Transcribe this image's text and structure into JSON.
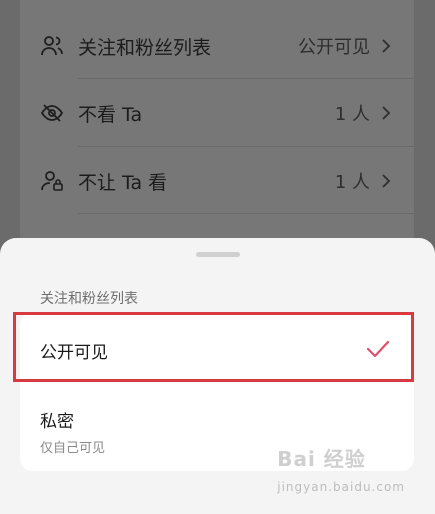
{
  "background_list": {
    "items": [
      {
        "icon": "people-icon",
        "label": "关注和粉丝列表",
        "value": "公开可见"
      },
      {
        "icon": "eye-off-icon",
        "label": "不看 Ta",
        "value": "1 人"
      },
      {
        "icon": "person-lock-icon",
        "label": "不让 Ta 看",
        "value": "1 人"
      }
    ]
  },
  "sheet": {
    "title": "关注和粉丝列表",
    "options": [
      {
        "label": "公开可见",
        "description": "",
        "selected": true
      },
      {
        "label": "私密",
        "description": "仅自己可见",
        "selected": false
      }
    ],
    "accent_color": "#e0506a",
    "highlight_color": "#d83a42"
  },
  "watermark": {
    "text": "Bai 经验",
    "sub": "jingyan.baidu.com"
  }
}
